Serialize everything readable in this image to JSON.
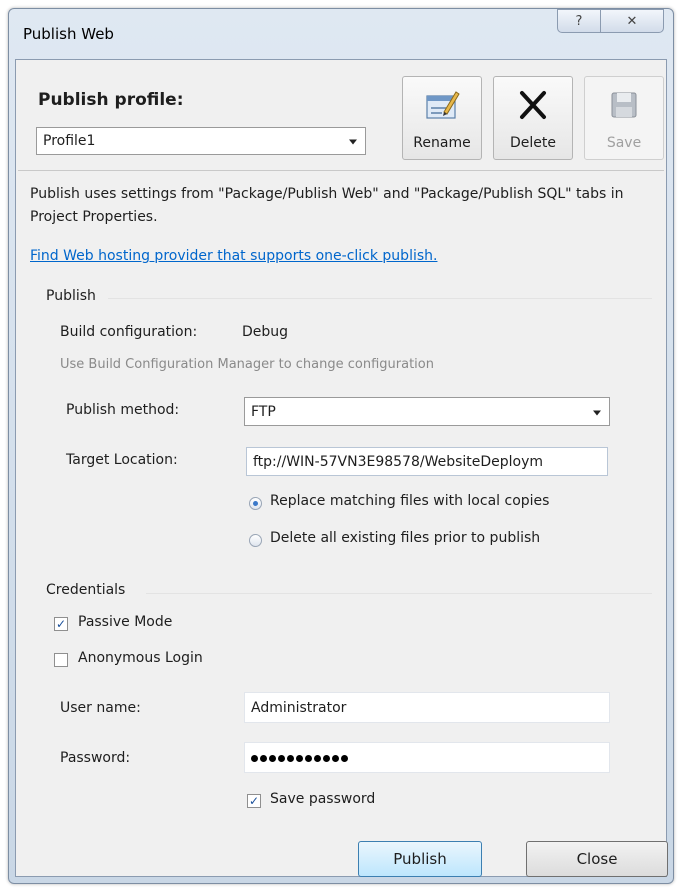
{
  "window": {
    "title": "Publish Web",
    "help_glyph": "?",
    "close_glyph": "✕"
  },
  "profile": {
    "label": "Publish profile:",
    "selected": "Profile1",
    "rename_label": "Rename",
    "delete_label": "Delete",
    "save_label": "Save"
  },
  "info": {
    "description": "Publish uses settings from \"Package/Publish Web\" and \"Package/Publish SQL\" tabs in Project Properties.",
    "link": "Find Web hosting provider that supports one-click publish."
  },
  "publish_group": {
    "header": "Publish",
    "build_config_label": "Build configuration:",
    "build_config_value": "Debug",
    "build_config_hint": "Use Build Configuration Manager to change configuration",
    "method_label": "Publish method:",
    "method_value": "FTP",
    "target_label": "Target Location:",
    "target_value": "ftp://WIN-57VN3E98578/WebsiteDeploym",
    "radio_replace": "Replace matching files with local copies",
    "radio_delete": "Delete all existing files prior to publish",
    "selected_radio": "replace"
  },
  "credentials": {
    "header": "Credentials",
    "passive_mode": "Passive Mode",
    "passive_checked": true,
    "anonymous_login": "Anonymous Login",
    "anonymous_checked": false,
    "username_label": "User name:",
    "username_value": "Administrator",
    "password_label": "Password:",
    "password_mask_count": 11,
    "save_password": "Save password",
    "save_password_checked": true
  },
  "footer": {
    "publish_label": "Publish",
    "close_label": "Close"
  },
  "colors": {
    "link": "#0066cc",
    "accent": "#3c7fb1"
  }
}
